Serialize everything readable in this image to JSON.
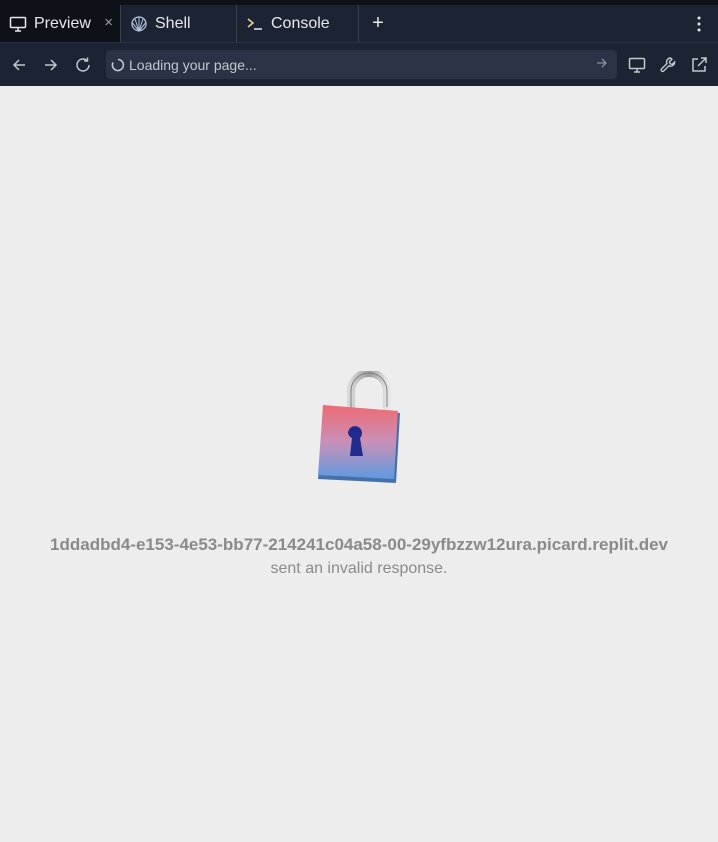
{
  "tabs": [
    {
      "label": "Preview",
      "icon": "monitor-icon",
      "active": true
    },
    {
      "label": "Shell",
      "icon": "shell-icon",
      "active": false
    },
    {
      "label": "Console",
      "icon": "terminal-icon",
      "active": false
    }
  ],
  "tabbar": {
    "close_glyph": "×",
    "new_tab_glyph": "+"
  },
  "address_bar": {
    "text": "Loading your page..."
  },
  "error": {
    "host": "1ddadbd4-e153-4e53-bb77-214241c04a58-00-29yfbzzw12ura.picard.replit.dev",
    "message": "sent an invalid response."
  },
  "colors": {
    "chrome_bg": "#1c2333",
    "active_tab_bg": "#0e1117",
    "page_bg": "#ededed",
    "error_text": "#8a8a8a"
  }
}
